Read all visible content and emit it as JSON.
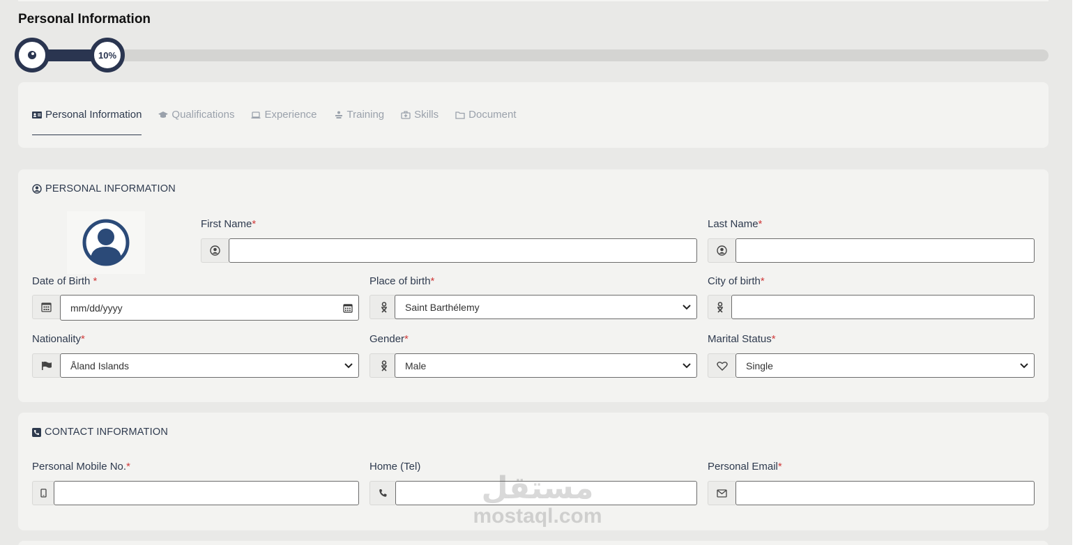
{
  "page": {
    "title": "Personal Information"
  },
  "progress": {
    "value_percent": 10,
    "label": "10%"
  },
  "tabs": [
    {
      "label": "Personal Information",
      "icon": "id-card-icon",
      "active": true
    },
    {
      "label": "Qualifications",
      "icon": "graduation-cap-icon",
      "active": false
    },
    {
      "label": "Experience",
      "icon": "laptop-icon",
      "active": false
    },
    {
      "label": "Training",
      "icon": "training-icon",
      "active": false
    },
    {
      "label": "Skills",
      "icon": "briefcase-medical-icon",
      "active": false
    },
    {
      "label": "Document",
      "icon": "folder-icon",
      "active": false
    }
  ],
  "personal": {
    "section_title": "PERSONAL INFORMATION",
    "first_name": {
      "label": "First Name",
      "required": "*",
      "value": ""
    },
    "last_name": {
      "label": "Last Name",
      "required": "*",
      "value": ""
    },
    "dob": {
      "label": "Date of Birth ",
      "required": "*",
      "placeholder": "mm/dd/yyyy"
    },
    "place_of_birth": {
      "label": "Place of birth",
      "required": "*",
      "value": "Saint Barthélemy"
    },
    "city_of_birth": {
      "label": "City of birth",
      "required": "*",
      "value": ""
    },
    "nationality": {
      "label": "Nationality",
      "required": "*",
      "value": "Åland Islands"
    },
    "gender": {
      "label": "Gender",
      "required": "*",
      "value": "Male"
    },
    "marital_status": {
      "label": "Marital Status",
      "required": "*",
      "value": "Single"
    }
  },
  "contact": {
    "section_title": "CONTACT INFORMATION",
    "mobile": {
      "label": "Personal Mobile No.",
      "required": "*",
      "value": ""
    },
    "home_tel": {
      "label": "Home (Tel)",
      "value": ""
    },
    "email": {
      "label": "Personal Email",
      "required": "*",
      "value": ""
    }
  },
  "watermark": {
    "arabic": "مستقل",
    "latin": "mostaql.com"
  },
  "colors": {
    "primary": "#2a3550",
    "required": "#d03a3a",
    "muted": "#9aa1ab",
    "background": "#e9e9e7",
    "card": "#f3f3f1"
  }
}
